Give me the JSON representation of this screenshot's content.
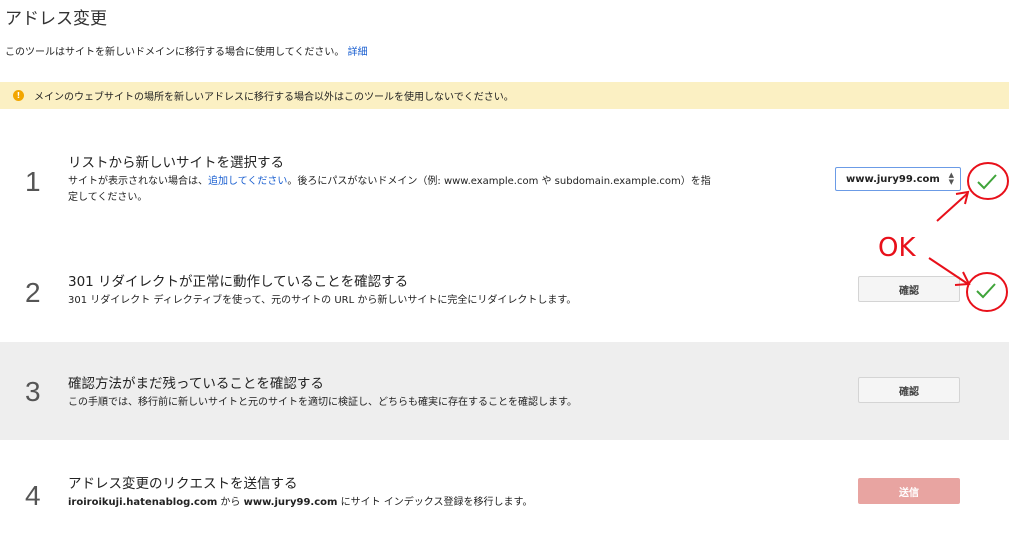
{
  "page": {
    "title": "アドレス変更",
    "intro_text": "このツールはサイトを新しいドメインに移行する場合に使用してください。",
    "intro_link": "詳細"
  },
  "warning": {
    "icon": "warning-icon",
    "text": "メインのウェブサイトの場所を新しいアドレスに移行する場合以外はこのツールを使用しないでください。",
    "color": "#fbf0c3"
  },
  "steps": [
    {
      "number": "1",
      "title": "リストから新しいサイトを選択する",
      "desc_before": "サイトが表示されない場合は、",
      "desc_link": "追加してください",
      "desc_after_line1": "。後ろにパスがないドメイン（例: www.example.com や subdomain.example.com）を指",
      "desc_line2": "定してください。",
      "select_value": "www.jury99.com"
    },
    {
      "number": "2",
      "title": "301 リダイレクトが正常に動作していることを確認する",
      "desc": "301 リダイレクト ディレクティブを使って、元のサイトの URL から新しいサイトに完全にリダイレクトします。",
      "button": "確認"
    },
    {
      "number": "3",
      "title": "確認方法がまだ残っていることを確認する",
      "desc": "この手順では、移行前に新しいサイトと元のサイトを適切に検証し、どちらも確実に存在することを確認します。",
      "button": "確認"
    },
    {
      "number": "4",
      "title": "アドレス変更のリクエストを送信する",
      "desc_old_site": "iroiroikuji.hatenablog.com",
      "desc_mid": " から ",
      "desc_new_site": "www.jury99.com",
      "desc_end": " にサイト インデックス登録を移行します。",
      "button": "送信"
    }
  ],
  "annotation": {
    "text": "OK",
    "color": "#e8101a",
    "check_color": "#3fa43a"
  }
}
